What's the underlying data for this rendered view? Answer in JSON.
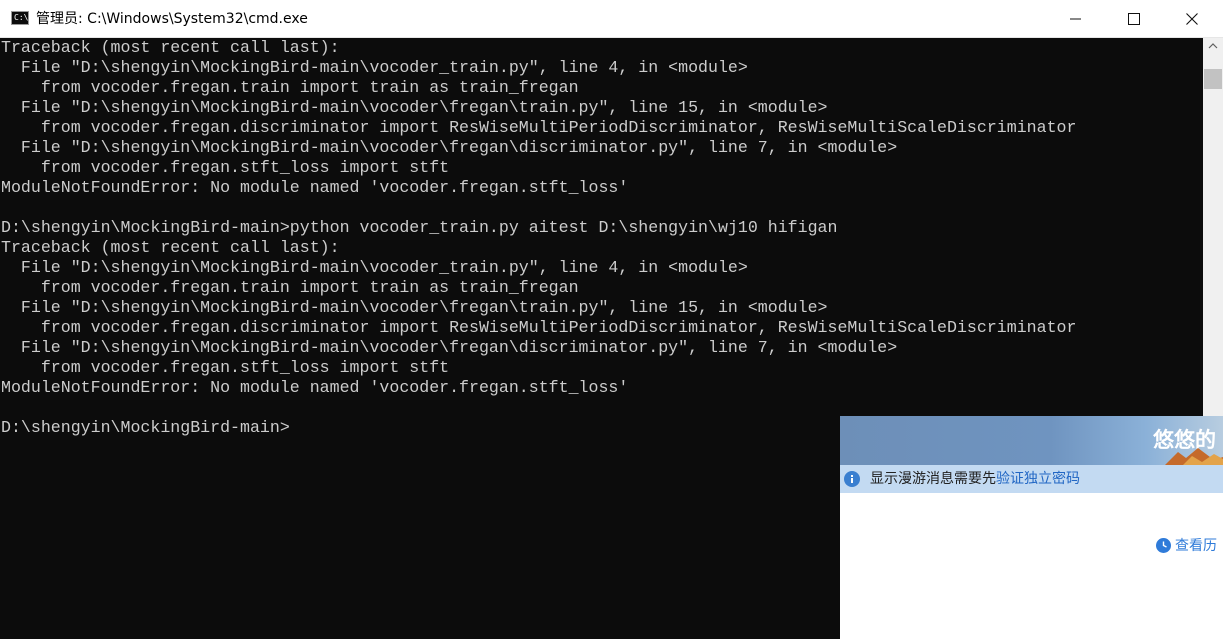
{
  "window": {
    "title": "管理员: C:\\Windows\\System32\\cmd.exe",
    "icon": "cmd-icon",
    "icon_label": "C:\\."
  },
  "console": {
    "lines": [
      "Traceback (most recent call last):",
      "  File \"D:\\shengyin\\MockingBird-main\\vocoder_train.py\", line 4, in <module>",
      "    from vocoder.fregan.train import train as train_fregan",
      "  File \"D:\\shengyin\\MockingBird-main\\vocoder\\fregan\\train.py\", line 15, in <module>",
      "    from vocoder.fregan.discriminator import ResWiseMultiPeriodDiscriminator, ResWiseMultiScaleDiscriminator",
      "  File \"D:\\shengyin\\MockingBird-main\\vocoder\\fregan\\discriminator.py\", line 7, in <module>",
      "    from vocoder.fregan.stft_loss import stft",
      "ModuleNotFoundError: No module named 'vocoder.fregan.stft_loss'",
      "",
      "D:\\shengyin\\MockingBird-main>python vocoder_train.py aitest D:\\shengyin\\wj10 hifigan",
      "Traceback (most recent call last):",
      "  File \"D:\\shengyin\\MockingBird-main\\vocoder_train.py\", line 4, in <module>",
      "    from vocoder.fregan.train import train as train_fregan",
      "  File \"D:\\shengyin\\MockingBird-main\\vocoder\\fregan\\train.py\", line 15, in <module>",
      "    from vocoder.fregan.discriminator import ResWiseMultiPeriodDiscriminator, ResWiseMultiScaleDiscriminator",
      "  File \"D:\\shengyin\\MockingBird-main\\vocoder\\fregan\\discriminator.py\", line 7, in <module>",
      "    from vocoder.fregan.stft_loss import stft",
      "ModuleNotFoundError: No module named 'vocoder.fregan.stft_loss'",
      "",
      "D:\\shengyin\\MockingBird-main>"
    ]
  },
  "popup": {
    "banner_text": "悠悠的",
    "info_text": "显示漫游消息需要先",
    "info_link": "验证独立密码",
    "history_link": "查看历"
  },
  "colors": {
    "console_bg": "#0c0c0c",
    "console_fg": "#cccccc",
    "link": "#2166c4",
    "info_bar": "#c3daf2"
  }
}
